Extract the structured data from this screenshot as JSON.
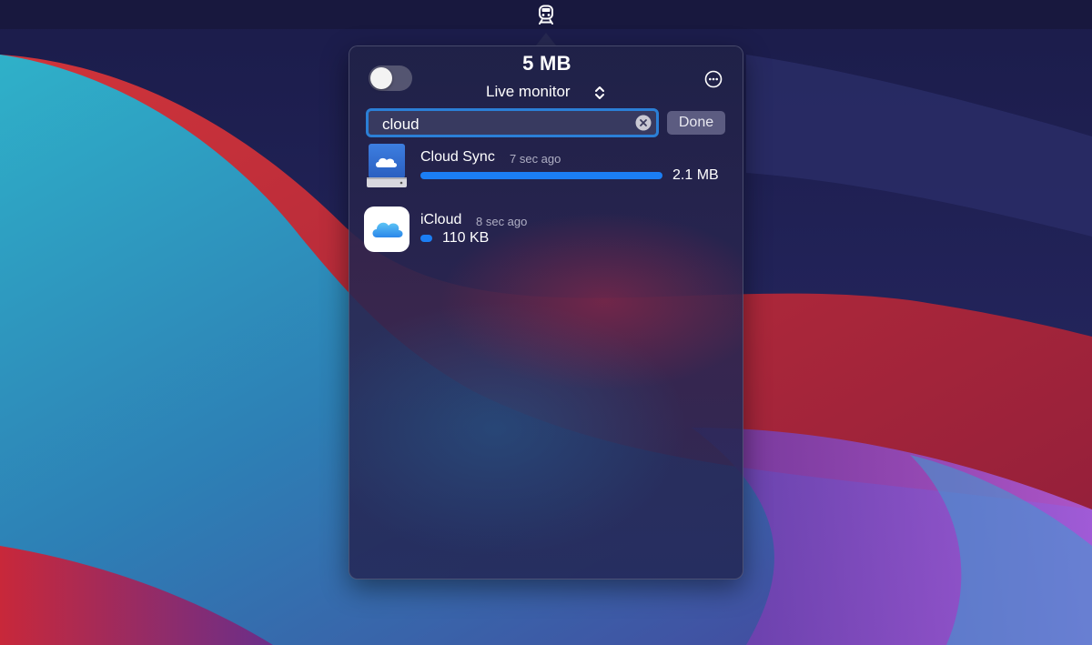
{
  "popover": {
    "total": "5 MB",
    "mode": "Live monitor",
    "monitor_enabled": false
  },
  "search": {
    "value": "cloud",
    "done_label": "Done"
  },
  "apps": [
    {
      "name": "Cloud Sync",
      "time": "7 sec ago",
      "size": "2.1 MB",
      "usage_fraction": 1.0,
      "icon": "cloud-drive-icon"
    },
    {
      "name": "iCloud",
      "time": "8 sec ago",
      "size": "110 KB",
      "usage_fraction": 0.05,
      "icon": "icloud-app-icon"
    }
  ],
  "menubar": {
    "icon": "train-icon"
  },
  "colors": {
    "accent": "#1b7ef4",
    "search_border": "#2b7fd6",
    "popover_bg": "#22244a"
  }
}
